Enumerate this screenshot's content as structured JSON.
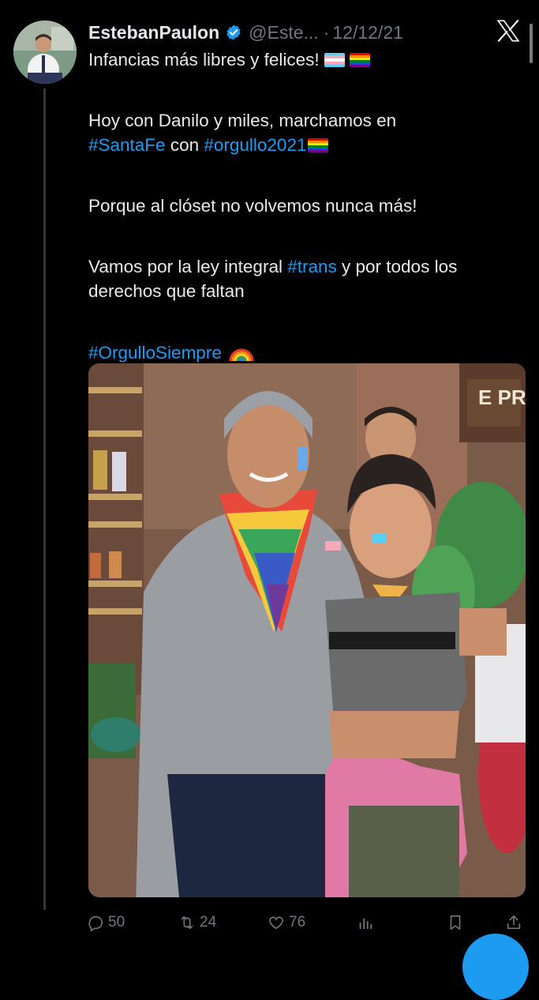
{
  "tweet": {
    "author_name": "EstebanPaulon",
    "handle": "@Este...",
    "separator": "·",
    "date": "12/12/21",
    "line1": "Infancias más libres y felices!",
    "line2a": "Hoy con Danilo y miles, marchamos en",
    "hashtag_santafe": "#SantaFe",
    "word_con": " con ",
    "hashtag_orgullo2021": "#orgullo2021",
    "line3": "Porque al clóset no volvemos nunca más!",
    "line4a": "Vamos por la ley integral ",
    "hashtag_trans": "#trans",
    "line4b": " y por todos los derechos que faltan",
    "hashtag_orgullosiempre": "#OrgulloSiempre"
  },
  "actions": {
    "replies": "50",
    "retweets": "24",
    "likes": "76"
  },
  "photo": {
    "sign_text": "E PRO"
  },
  "colors": {
    "background": "#000000",
    "text": "#e7e9ea",
    "muted": "#71767b",
    "accent": "#1d9bf0"
  },
  "icons": [
    "verified-badge-icon",
    "x-logo-icon",
    "reply-icon",
    "retweet-icon",
    "like-icon",
    "views-icon",
    "bookmark-icon",
    "share-icon"
  ]
}
